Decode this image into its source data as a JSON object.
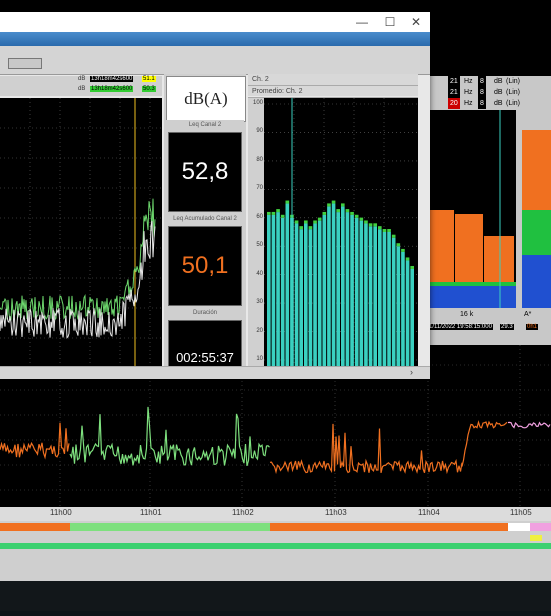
{
  "window": {
    "min_glyph": "—",
    "max_glyph": "☐",
    "close_glyph": "✕",
    "scroll_glyph": "›"
  },
  "markers": [
    {
      "label": "dB",
      "time": "13h18m42s600",
      "value": "51.1"
    },
    {
      "label": "dB",
      "time": "13h18m42s600",
      "value": "50.3"
    }
  ],
  "unit_title": "dB(A)",
  "leq_label": "Leq Canal 2",
  "leq_value": "52,8",
  "leq_acc_label": "Leq Acumulado Canal 2",
  "leq_acc_value": "50,1",
  "duration_label": "Duración",
  "duration_value": "002:55:37",
  "channel": {
    "name": "Ch. 2",
    "avg": "Promedio: Ch. 2"
  },
  "spectrum": {
    "yticks": [
      "100",
      "90",
      "80",
      "70",
      "60",
      "50",
      "40",
      "30",
      "20",
      "10"
    ],
    "values": [
      61,
      61,
      62,
      60,
      65,
      60,
      58,
      56,
      58,
      56,
      58,
      59,
      61,
      64,
      65,
      62,
      64,
      62,
      61,
      60,
      59,
      58,
      57,
      57,
      56,
      55,
      55,
      53,
      50,
      48,
      45,
      42
    ]
  },
  "right_panel": {
    "rows": [
      {
        "c1": "21",
        "c2": "Hz",
        "c3": "8",
        "c4": "dB",
        "c5": "(Lin)"
      },
      {
        "c1": "21",
        "c2": "Hz",
        "c3": "8",
        "c4": "dB",
        "c5": "(Lin)"
      },
      {
        "c1": "20",
        "c2": "Hz",
        "c3": "8",
        "c4": "dB",
        "c5": "(Lin)"
      }
    ],
    "freq_label": "16 k",
    "a_label": "A*",
    "timestamp": "1/11/2022 19:58:15:000",
    "val1": "29.3",
    "val2": "0h1"
  },
  "timeline": {
    "ticks": [
      "11h00",
      "11h01",
      "11h02",
      "11h03",
      "11h04",
      "11h05"
    ]
  },
  "colors": {
    "orange": "#f07020",
    "green": "#7ee07e",
    "pink": "#f0a0e0",
    "teal": "#3ad0c0"
  }
}
